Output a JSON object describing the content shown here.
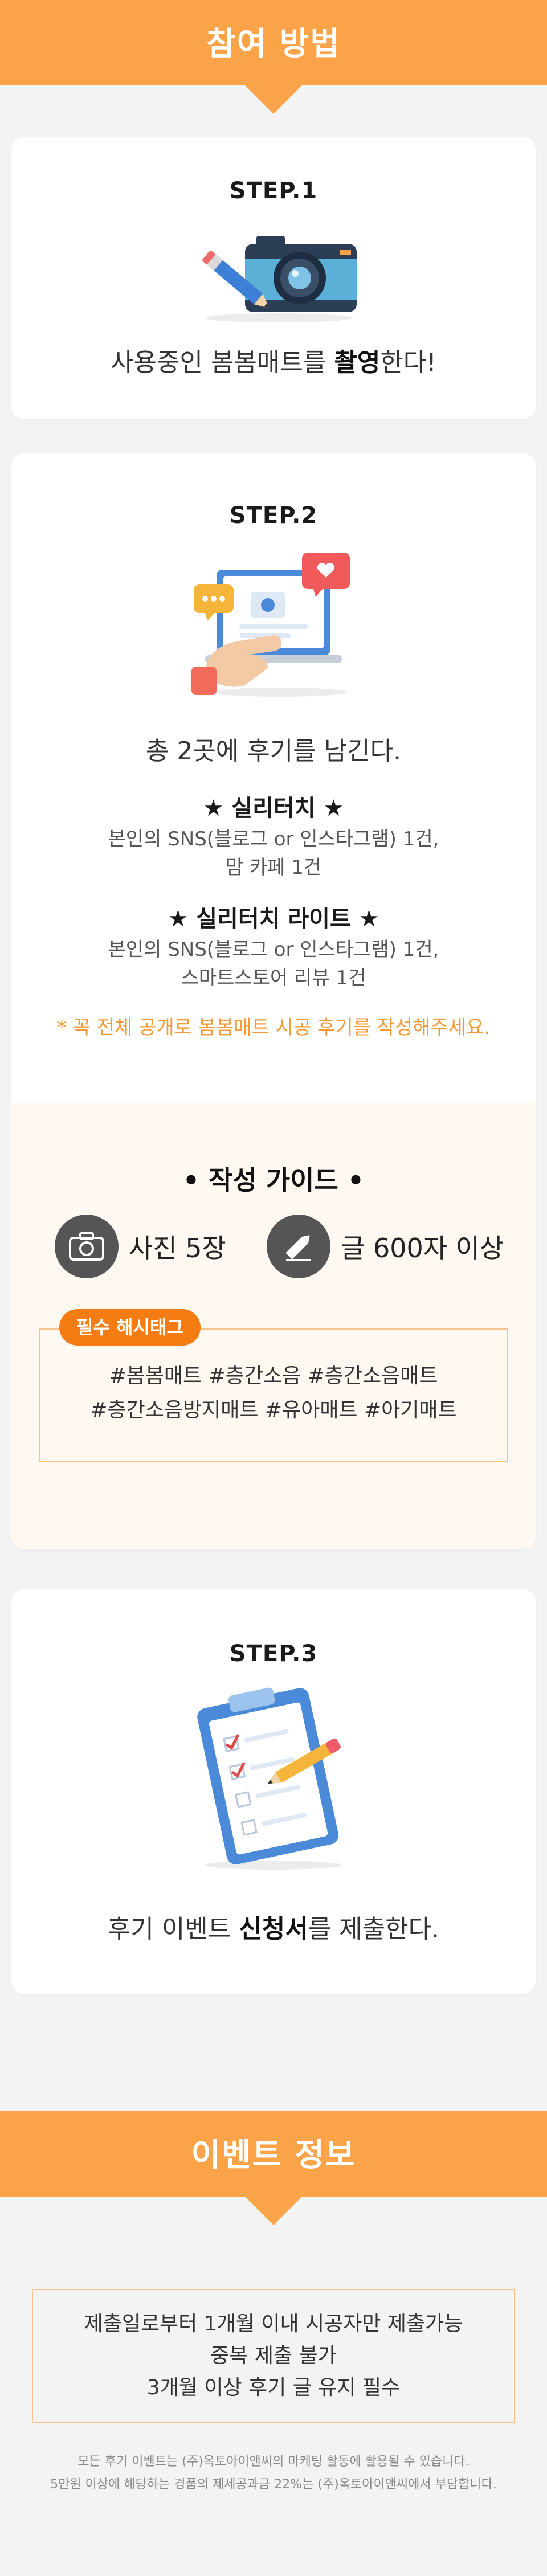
{
  "header": {
    "title": "참여 방법"
  },
  "step1": {
    "label": "STEP.1",
    "text_before": "사용중인 봄봄매트를 ",
    "text_bold": "촬영",
    "text_after": "한다!"
  },
  "step2": {
    "label": "STEP.2",
    "text": "총 2곳에 후기를 남긴다.",
    "types": [
      {
        "title": "★ 실리터치 ★",
        "desc1": "본인의 SNS(블로그 or 인스타그램) 1건,",
        "desc2": "맘 카페 1건"
      },
      {
        "title": "★ 실리터치 라이트 ★",
        "desc1": "본인의 SNS(블로그 or 인스타그램) 1건,",
        "desc2": "스마트스토어 리뷰 1건"
      }
    ],
    "notice": "* 꼭 전체 공개로 봄봄매트 시공 후기를 작성해주세요."
  },
  "guide": {
    "title": "• 작성 가이드 •",
    "photo": "사진 5장",
    "text": "글 600자 이상",
    "tag_label": "필수 해시태그",
    "tags_line1": "#봄봄매트 #층간소음 #층간소음매트",
    "tags_line2": "#층간소음방지매트 #유아매트 #아기매트",
    "icon_photo": "camera-icon",
    "icon_text": "pencil-icon"
  },
  "step3": {
    "label": "STEP.3",
    "text_before": "후기 이벤트 ",
    "text_bold": "신청서",
    "text_after": "를 제출한다."
  },
  "event_info": {
    "title": "이벤트 정보",
    "lines": [
      "제출일로부터 1개월 이내 시공자만 제출가능",
      "중복 제출 불가",
      "3개월 이상 후기 글 유지 필수"
    ],
    "fine1": "모든 후기 이벤트는 (주)옥토아이앤씨의 마케팅 활동에 활용될 수 있습니다.",
    "fine2": "5만원 이상에 해당하는 경품의 제세공과금 22%는 (주)옥토아이앤씨에서 부담합니다."
  },
  "colors": {
    "accent": "#fba348",
    "tag_pill": "#f47c12",
    "notice": "#f59a35"
  }
}
